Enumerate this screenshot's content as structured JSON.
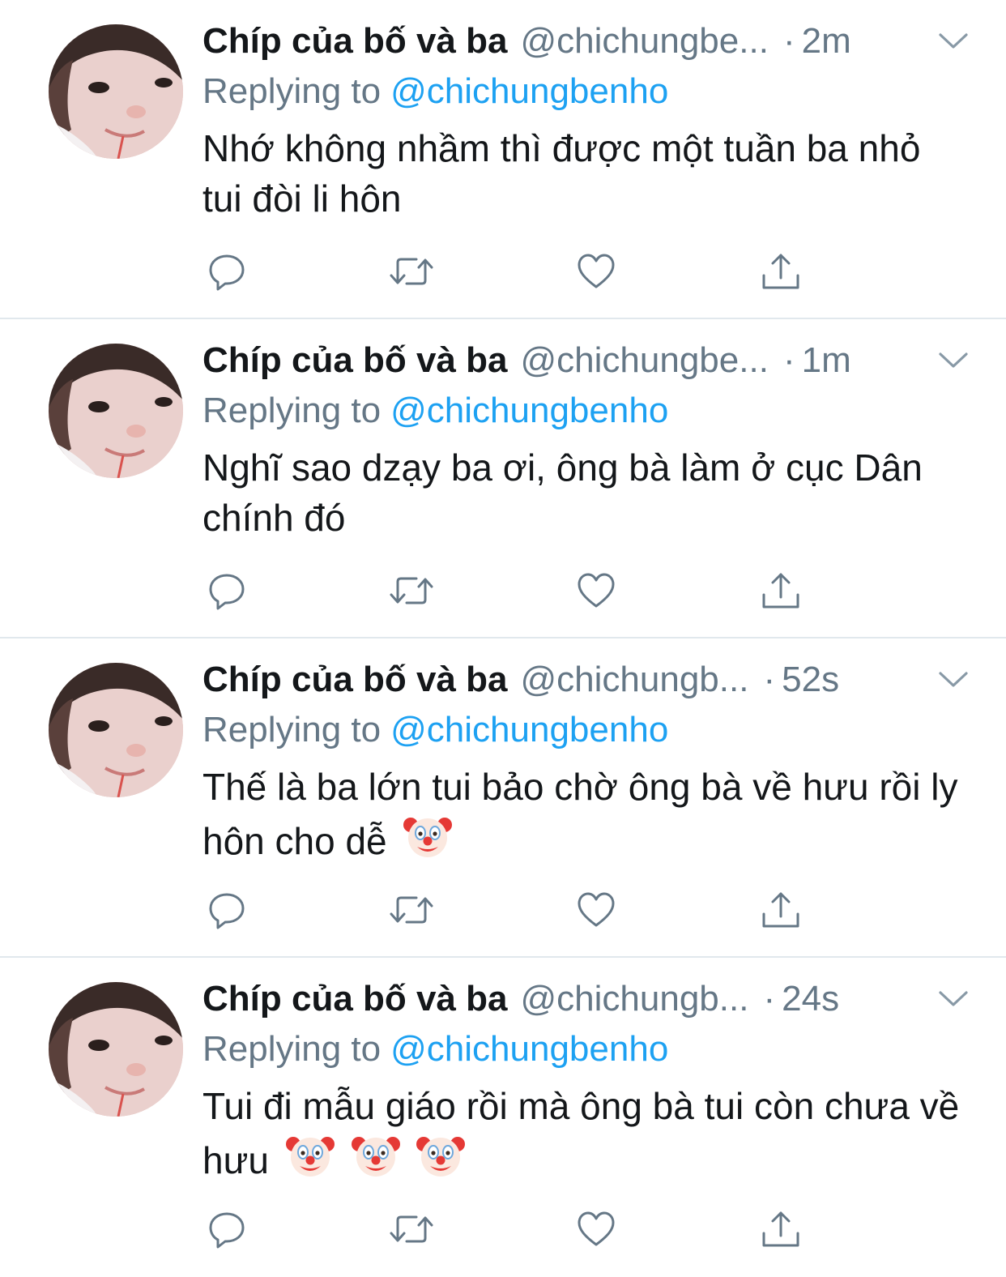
{
  "tweets": [
    {
      "name": "Chíp của bố và ba",
      "handle": "@chichungbe...",
      "dot": "·",
      "time": "2m",
      "replying_label": "Replying to",
      "replying_to": "@chichungbenho",
      "text": "Nhớ không nhầm thì được một tuần ba nhỏ tui đòi li hôn",
      "emojis": []
    },
    {
      "name": "Chíp của bố và ba",
      "handle": "@chichungbe...",
      "dot": "·",
      "time": "1m",
      "replying_label": "Replying to",
      "replying_to": "@chichungbenho",
      "text": "Nghĩ sao dzạy ba ơi, ông bà làm ở cục Dân chính đó",
      "emojis": []
    },
    {
      "name": "Chíp của bố và ba",
      "handle": "@chichungb...",
      "dot": "·",
      "time": "52s",
      "replying_label": "Replying to",
      "replying_to": "@chichungbenho",
      "text": "Thế là ba lớn tui bảo chờ ông bà về hưu rồi ly hôn cho dễ",
      "emojis": [
        "clown-face-emoji"
      ]
    },
    {
      "name": "Chíp của bố và ba",
      "handle": "@chichungb...",
      "dot": "·",
      "time": "24s",
      "replying_label": "Replying to",
      "replying_to": "@chichungbenho",
      "text": "Tui đi mẫu giáo rồi mà ông bà tui còn chưa về hưu",
      "emojis": [
        "clown-face-emoji",
        "clown-face-emoji",
        "clown-face-emoji"
      ]
    }
  ],
  "icons": {
    "caret": "chevron-down-icon",
    "reply": "reply-icon",
    "retweet": "retweet-icon",
    "like": "heart-icon",
    "share": "share-icon"
  },
  "colors": {
    "link": "#1da1f2",
    "secondary": "#657786",
    "text": "#14171a",
    "divider": "#e1e8ed"
  }
}
